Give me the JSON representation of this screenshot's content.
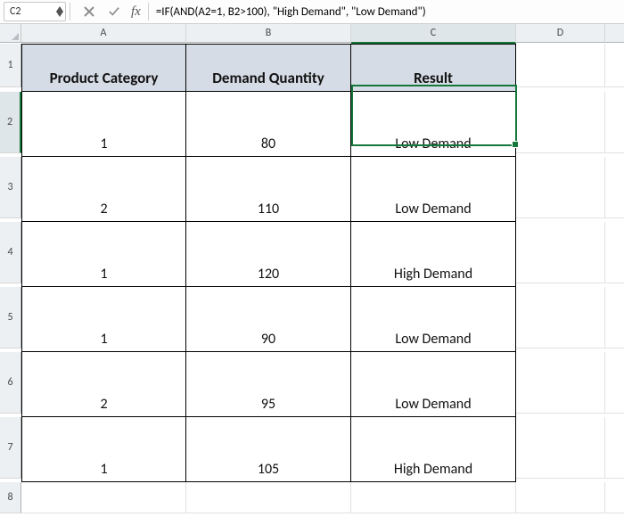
{
  "formulabar": {
    "name_box": "C2",
    "cancel_tip": "Cancel",
    "accept_tip": "Enter",
    "fx_label": "fx",
    "formula": "=IF(AND(A2=1, B2>100), \"High Demand\", \"Low Demand\")"
  },
  "columns": [
    "A",
    "B",
    "C",
    "D"
  ],
  "row_numbers": [
    "1",
    "2",
    "3",
    "4",
    "5",
    "6",
    "7",
    "8"
  ],
  "table": {
    "headers": {
      "a": "Product Category",
      "b": "Demand Quantity",
      "c": "Result"
    },
    "rows": [
      {
        "a": "1",
        "b": "80",
        "c": "Low Demand"
      },
      {
        "a": "2",
        "b": "110",
        "c": "Low Demand"
      },
      {
        "a": "1",
        "b": "120",
        "c": "High Demand"
      },
      {
        "a": "1",
        "b": "90",
        "c": "Low Demand"
      },
      {
        "a": "2",
        "b": "95",
        "c": "Low Demand"
      },
      {
        "a": "1",
        "b": "105",
        "c": "High Demand"
      }
    ]
  },
  "selection": {
    "cell": "C2"
  }
}
